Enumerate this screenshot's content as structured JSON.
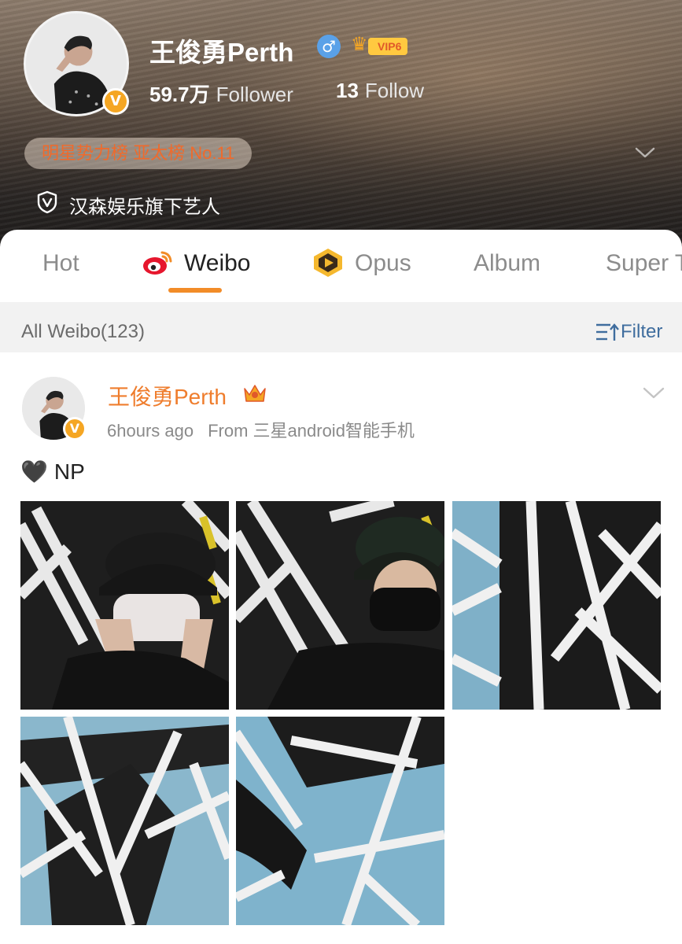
{
  "profile": {
    "name": "王俊勇Perth",
    "gender_icon": "male-icon",
    "gender_symbol": "♂",
    "vip_label": "VIP6",
    "followers_count": "59.7万",
    "followers_label": "Follower",
    "follow_count": "13",
    "follow_label": "Follow",
    "rank_text": "明星势力榜 亚太榜 No.11",
    "agency_text": "汉森娱乐旗下艺人",
    "verified_mark": "V"
  },
  "tabs": [
    {
      "label": "Hot",
      "active": false
    },
    {
      "label": "Weibo",
      "active": true
    },
    {
      "label": "Opus",
      "active": false
    },
    {
      "label": "Album",
      "active": false
    },
    {
      "label": "Super T",
      "active": false
    }
  ],
  "filter_bar": {
    "all_label": "All Weibo(123)",
    "filter_label": "Filter"
  },
  "post": {
    "author": "王俊勇Perth",
    "time": "6hours ago",
    "source": "From 三星android智能手机",
    "heart": "🖤",
    "text": "NP",
    "photo_count": 5
  },
  "colors": {
    "accent_orange": "#f28c28",
    "author_orange": "#ef7d2d",
    "verified_gold": "#f5a623",
    "filter_blue": "#3f6d9e",
    "rank_text": "#f06a2b"
  }
}
